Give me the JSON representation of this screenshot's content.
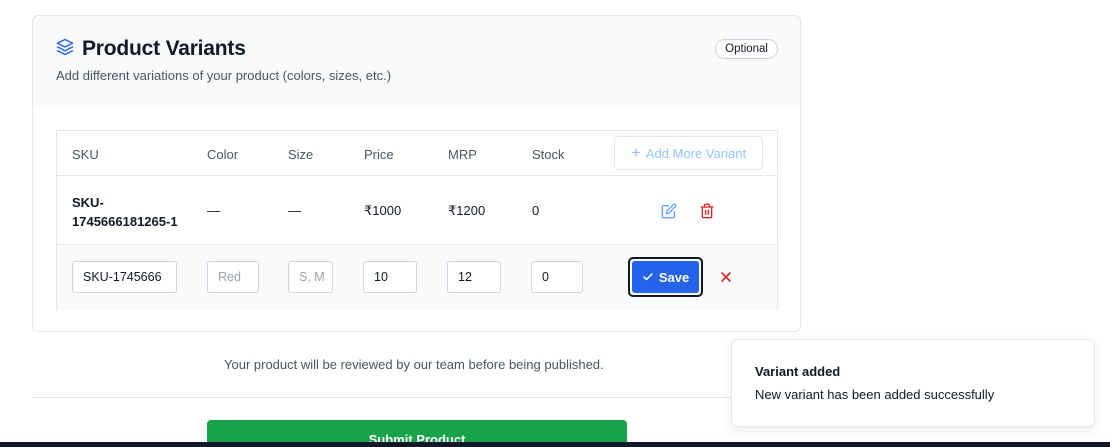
{
  "section": {
    "title": "Product Variants",
    "subtitle": "Add different variations of your product (colors, sizes, etc.)",
    "badge": "Optional",
    "icon": "layers-icon"
  },
  "table": {
    "headers": [
      "SKU",
      "Color",
      "Size",
      "Price",
      "MRP",
      "Stock"
    ],
    "add_button_label": "Add More Variant",
    "rows": [
      {
        "sku": "SKU-1745666181265-1",
        "color": "—",
        "size": "—",
        "price": "₹1000",
        "mrp": "₹1200",
        "stock": "0"
      }
    ],
    "edit_row": {
      "sku_value": "SKU-1745666",
      "color_placeholder": "Red",
      "size_placeholder": "S, M",
      "price_value": "10",
      "mrp_value": "12",
      "stock_value": "0",
      "save_label": "Save"
    }
  },
  "footer": {
    "review_note": "Your product will be reviewed by our team before being published.",
    "submit_label": "Submit Product"
  },
  "toast": {
    "title": "Variant added",
    "message": "New variant has been added successfully"
  },
  "colors": {
    "primary": "#2563eb",
    "success": "#16a34a",
    "danger": "#dc2626",
    "muted_accent": "#93c5fd"
  }
}
